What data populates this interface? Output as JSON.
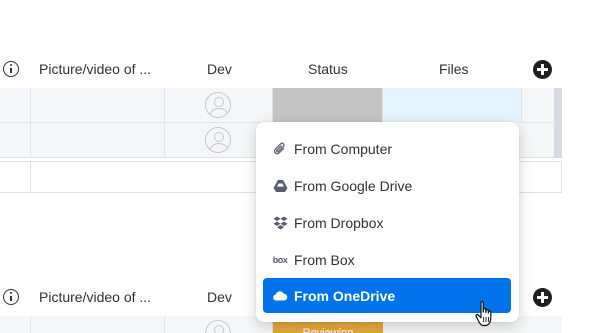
{
  "table": {
    "columns": {
      "picture": "Picture/video of ...",
      "dev": "Dev",
      "status": "Status",
      "files": "Files"
    }
  },
  "status_badge": "Reviewing",
  "file_menu": {
    "items": [
      {
        "label": "From Computer",
        "icon": "paperclip-icon"
      },
      {
        "label": "From Google Drive",
        "icon": "google-drive-icon"
      },
      {
        "label": "From Dropbox",
        "icon": "dropbox-icon"
      },
      {
        "label": "From Box",
        "icon": "box-icon"
      },
      {
        "label": "From OneDrive",
        "icon": "onedrive-icon",
        "highlighted": true
      }
    ]
  },
  "colors": {
    "accent": "#0073ea",
    "status_gray": "#c4c4c4",
    "status_reviewing": "#e8a83e",
    "files_cell": "#e5f4ff"
  }
}
